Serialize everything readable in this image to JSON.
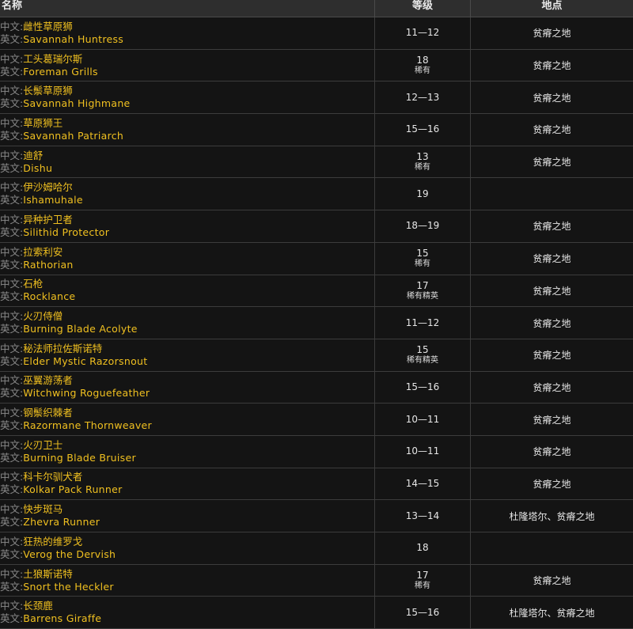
{
  "header": {
    "name": "名称",
    "level": "等级",
    "location": "地点"
  },
  "labels": {
    "cn": "中文:",
    "en": "英文:"
  },
  "rows": [
    {
      "cn": "雌性草原狮",
      "en": "Savannah Huntress",
      "level": "11—12",
      "tag": "",
      "location": "贫瘠之地"
    },
    {
      "cn": "工头葛瑞尔斯",
      "en": "Foreman Grills",
      "level": "18",
      "tag": "稀有",
      "location": "贫瘠之地"
    },
    {
      "cn": "长鬃草原狮",
      "en": "Savannah Highmane",
      "level": "12—13",
      "tag": "",
      "location": "贫瘠之地"
    },
    {
      "cn": "草原狮王",
      "en": "Savannah Patriarch",
      "level": "15—16",
      "tag": "",
      "location": "贫瘠之地"
    },
    {
      "cn": "迪舒",
      "en": "Dishu",
      "level": "13",
      "tag": "稀有",
      "location": "贫瘠之地"
    },
    {
      "cn": "伊沙姆哈尔",
      "en": "Ishamuhale",
      "level": "19",
      "tag": "",
      "location": ""
    },
    {
      "cn": "异种护卫者",
      "en": "Silithid Protector",
      "level": "18—19",
      "tag": "",
      "location": "贫瘠之地"
    },
    {
      "cn": "拉索利安",
      "en": "Rathorian",
      "level": "15",
      "tag": "稀有",
      "location": "贫瘠之地"
    },
    {
      "cn": "石枪",
      "en": "Rocklance",
      "level": "17",
      "tag": "稀有精英",
      "location": "贫瘠之地"
    },
    {
      "cn": "火刃侍僧",
      "en": "Burning Blade Acolyte",
      "level": "11—12",
      "tag": "",
      "location": "贫瘠之地"
    },
    {
      "cn": "秘法师拉佐斯诺特",
      "en": "Elder Mystic Razorsnout",
      "level": "15",
      "tag": "稀有精英",
      "location": "贫瘠之地"
    },
    {
      "cn": "巫翼游荡者",
      "en": "Witchwing Roguefeather",
      "level": "15—16",
      "tag": "",
      "location": "贫瘠之地"
    },
    {
      "cn": "钢鬃织棘者",
      "en": "Razormane Thornweaver",
      "level": "10—11",
      "tag": "",
      "location": "贫瘠之地"
    },
    {
      "cn": "火刃卫士",
      "en": "Burning Blade Bruiser",
      "level": "10—11",
      "tag": "",
      "location": "贫瘠之地"
    },
    {
      "cn": "科卡尔驯犬者",
      "en": "Kolkar Pack Runner",
      "level": "14—15",
      "tag": "",
      "location": "贫瘠之地"
    },
    {
      "cn": "快步斑马",
      "en": "Zhevra Runner",
      "level": "13—14",
      "tag": "",
      "location": "杜隆塔尔、贫瘠之地"
    },
    {
      "cn": "狂热的维罗戈",
      "en": "Verog the Dervish",
      "level": "18",
      "tag": "",
      "location": ""
    },
    {
      "cn": "土狼斯诺特",
      "en": "Snort the Heckler",
      "level": "17",
      "tag": "稀有",
      "location": "贫瘠之地"
    },
    {
      "cn": "长颈鹿",
      "en": "Barrens Giraffe",
      "level": "15—16",
      "tag": "",
      "location": "杜隆塔尔、贫瘠之地"
    }
  ]
}
